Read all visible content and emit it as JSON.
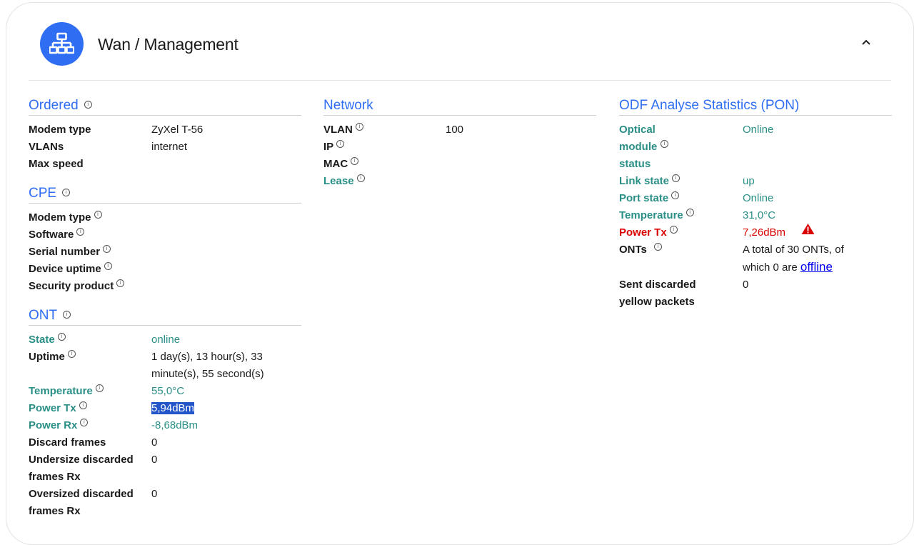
{
  "header": {
    "title": "Wan / Management",
    "icon": "network-icon",
    "collapse_icon": "chevron-up-icon",
    "accent_color": "#2f6ef2"
  },
  "ordered": {
    "title": "Ordered",
    "rows": [
      {
        "label": "Modem type",
        "value": "ZyXel T-56"
      },
      {
        "label": "VLANs",
        "value": "internet"
      },
      {
        "label": "Max speed",
        "value": ""
      }
    ]
  },
  "cpe": {
    "title": "CPE",
    "rows": [
      {
        "label": "Modem type",
        "value": ""
      },
      {
        "label": "Software",
        "value": ""
      },
      {
        "label": "Serial number",
        "value": ""
      },
      {
        "label": "Device uptime",
        "value": ""
      },
      {
        "label": "Security product",
        "value": ""
      }
    ]
  },
  "ont": {
    "title": "ONT",
    "rows": [
      {
        "label": "State",
        "value": "online"
      },
      {
        "label": "Uptime",
        "value": "1 day(s), 13 hour(s), 33 minute(s), 55 second(s)"
      },
      {
        "label": "Temperature",
        "value": "55,0°C"
      },
      {
        "label": "Power Tx",
        "value": "5,94dBm"
      },
      {
        "label": "Power Rx",
        "value": "-8,68dBm"
      },
      {
        "label": "Discard frames",
        "value": "0"
      },
      {
        "label": "Undersize discarded frames Rx",
        "value": "0"
      },
      {
        "label": "Oversized discarded frames Rx",
        "value": "0"
      }
    ]
  },
  "network": {
    "title": "Network",
    "rows": [
      {
        "label": "VLAN",
        "value": "100"
      },
      {
        "label": "IP",
        "value": ""
      },
      {
        "label": "MAC",
        "value": ""
      },
      {
        "label": "Lease",
        "value": ""
      }
    ]
  },
  "odf": {
    "title": "ODF Analyse Statistics (PON)",
    "rows": [
      {
        "label": "Optical module status",
        "value": "Online"
      },
      {
        "label": "Link state",
        "value": "up"
      },
      {
        "label": "Port state",
        "value": "Online"
      },
      {
        "label": "Temperature",
        "value": "31,0°C"
      },
      {
        "label": "Power Tx",
        "value": "7,26dBm",
        "warning_icon": "warning-icon"
      },
      {
        "label": "ONTs",
        "value_prefix": "A total of 30 ONTs, of which 0 are",
        "link": "offline"
      },
      {
        "label": "Sent discarded yellow packets",
        "value": "0"
      }
    ]
  },
  "colors": {
    "teal": "#2a8f86",
    "red": "#d80000",
    "selection": "#2255c8"
  }
}
